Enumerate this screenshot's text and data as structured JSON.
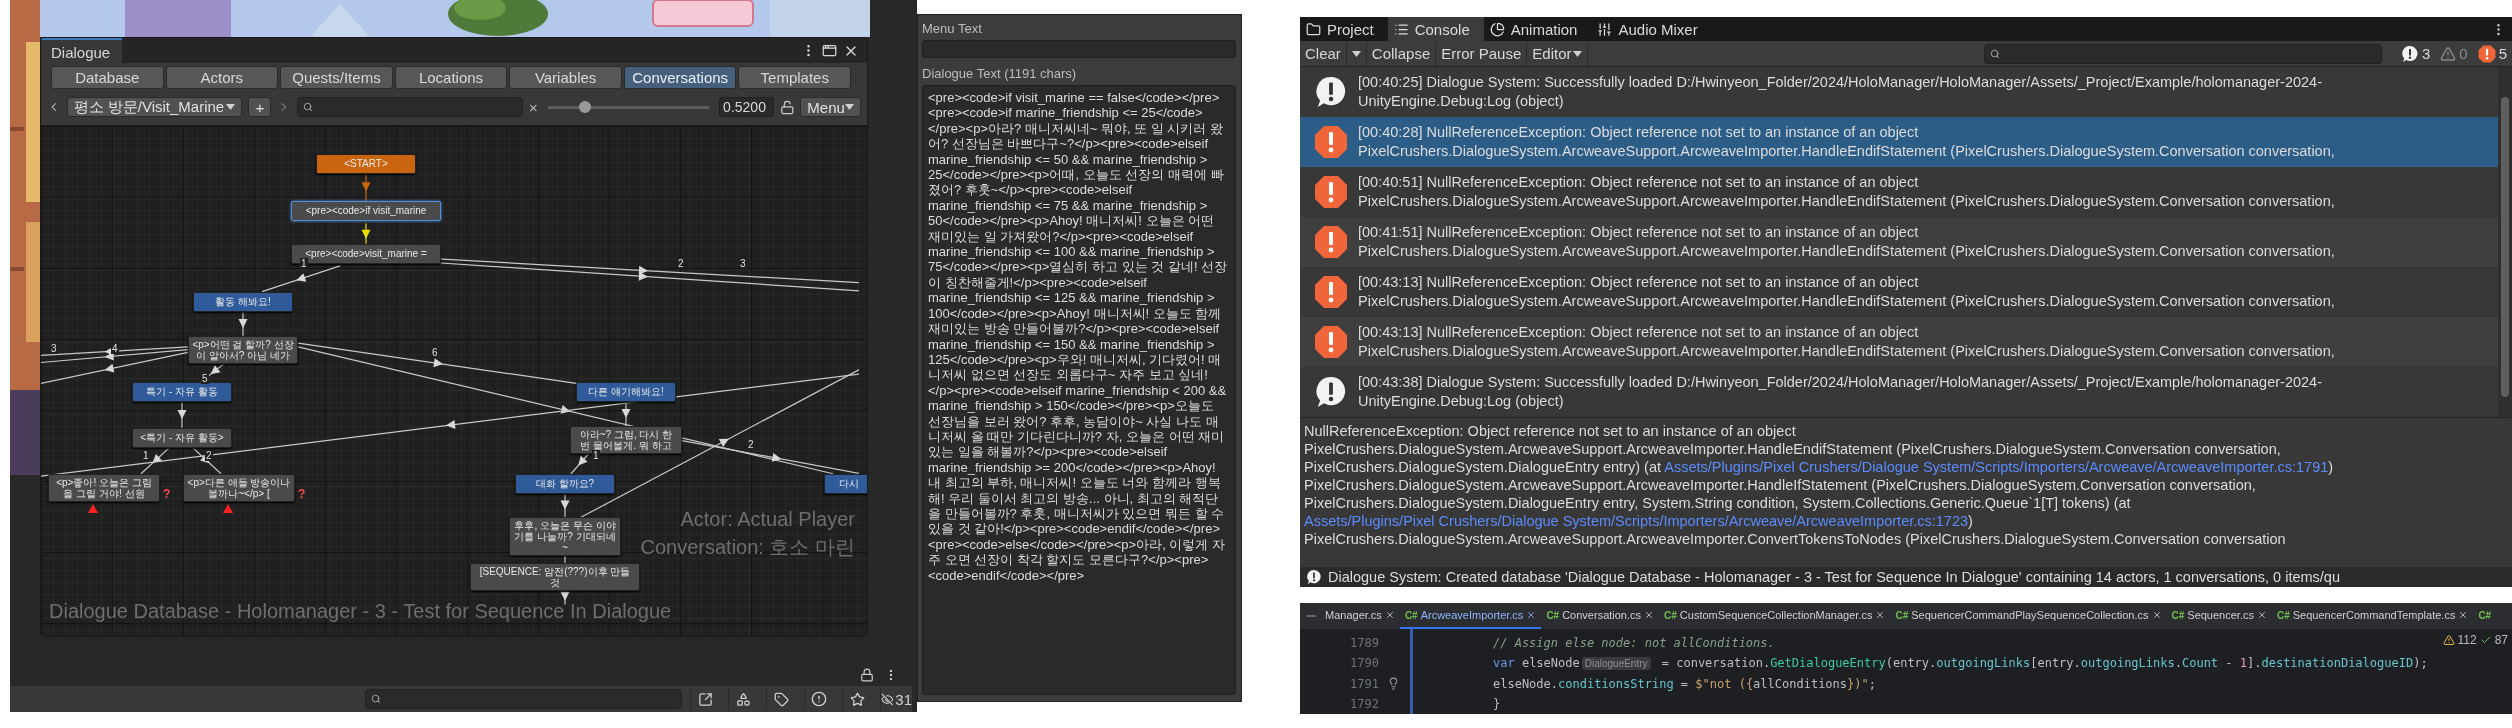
{
  "dialogue_window": {
    "title": "Dialogue",
    "tabs": [
      {
        "label": "Database",
        "selected": false
      },
      {
        "label": "Actors",
        "selected": false
      },
      {
        "label": "Quests/Items",
        "selected": false
      },
      {
        "label": "Locations",
        "selected": false
      },
      {
        "label": "Variables",
        "selected": false
      },
      {
        "label": "Conversations",
        "selected": true
      },
      {
        "label": "Templates",
        "selected": false
      }
    ],
    "toolbar": {
      "conversation": "평소 방문/Visit_Marine",
      "add": "+",
      "clear": "×",
      "zoom_slider": {
        "level": 0.23
      },
      "zoom_value": "0.5200",
      "menu": "Menu"
    },
    "graph": {
      "nodes": [
        {
          "text": "<START>",
          "kind": "start",
          "selected": false
        },
        {
          "text": "<pre><code>if visit_marine",
          "kind": "npc",
          "selected": true
        },
        {
          "text": "<pre><code>visit_marine =",
          "kind": "npc",
          "selected": false
        },
        {
          "text": "활동 해봐요!",
          "kind": "player",
          "selected": false
        },
        {
          "text": "<p>어떤 걸 할까? 선장이 알아서? 아님 네가",
          "kind": "npc",
          "selected": false
        },
        {
          "text": "특기 - 자유 활동",
          "kind": "player",
          "selected": false
        },
        {
          "text": "<특기 - 자유 활동>",
          "kind": "npc",
          "selected": false
        },
        {
          "text": "<p>좋아! 오늘은 그림을 그릴 거야! 선원",
          "kind": "npc",
          "selected": false,
          "flag": "?"
        },
        {
          "text": "<p>다른 애들 방송이나 볼까나~</p> [",
          "kind": "npc",
          "selected": false,
          "flag": "?"
        },
        {
          "text": "다른 얘기해봐요!",
          "kind": "player",
          "selected": false
        },
        {
          "text": "아라~? 그럼, 다시 한 번 물어볼게. 뭐 하고",
          "kind": "npc",
          "selected": false
        },
        {
          "text": "대화 할까요?",
          "kind": "player",
          "selected": false
        },
        {
          "text": "다시",
          "kind": "player",
          "selected": false
        },
        {
          "text": "후후, 오늘은 무슨 이야기를 나눌까? 기대되네~",
          "kind": "npc",
          "selected": false
        },
        {
          "text": "[SEQUENCE: 암전(???)이후 만들 것",
          "kind": "npc",
          "selected": false
        }
      ],
      "link_labels": [
        "1",
        "2",
        "3",
        "3",
        "4",
        "5",
        "6",
        "1",
        "2",
        "1",
        "2"
      ],
      "actor": "Actor: Actual Player",
      "database": "Dialogue Database - Holomanager - 3 - Test for Sequence In Dialogue",
      "conversation": "Conversation: 호소 마린"
    }
  },
  "bottom_bar": {
    "hidden_count": "31"
  },
  "inspector": {
    "menu_text_label": "Menu Text",
    "dialogue_text_label": "Dialogue Text (1191 chars)",
    "dialogue_text": "<pre><code>if visit_marine == false</code></pre><pre><code>if marine_friendship <= 25</code></pre><p>아라? 매니저씨네~ 뭐야, 또 일 시키러 왔어? 선장님은 바쁘다구~?</p><pre><code>elseif marine_friendship <= 50 && marine_friendship > 25</code></pre><p>어때, 오늘도 선장의 매력에 빠졌어? 후훗~</p><pre><code>elseif marine_friendship <= 75 && marine_friendship > 50</code></pre><p>Ahoy! 매니저씨! 오늘은 어떤 재미있는 일 가져왔어?</p><pre><code>elseif marine_friendship <= 100 && marine_friendship > 75</code></pre><p>열심히 하고 있는 것 같네! 선장이 칭찬해줄게!</p><pre><code>elseif marine_friendship <= 125 && marine_friendship > 100</code></pre><p>Ahoy! 매니저씨! 오늘도 함께 재미있는 방송 만들어볼까?</p><pre><code>elseif marine_friendship <= 150 && marine_friendship > 125</code></pre><p>우와! 매니저씨, 기다렸어! 매니저씨 없으면 선장도 외롭다구~ 자주 보고 싶네!</p><pre><code>elseif marine_friendship < 200 && marine_friendship > 150</code></pre><p>오늘도 선장님을 보러 왔어? 후후, 농담이야~ 사실 나도 매니저씨 올 때만 기다린다니까? 자, 오늘은 어떤 재미있는 일을 해볼까?</p><pre><code>elseif marine_friendship >= 200</code></pre><p>Ahoy! 내 최고의 부하, 매니저씨! 오늘도 너와 함께라 행복해! 우리 둘이서 최고의 방송... 아니, 최고의 해적단을 만들어볼까? 후훗, 매니저씨가 있으면 뭐든 할 수 있을 것 같아!</p><pre><code>endif</code></pre><pre><code>else</code></pre><p>아라, 이렇게 자주 오면 선장이 착각 할지도 모른다구?</p><pre><code>endif</code></pre>"
  },
  "console": {
    "tabs": [
      {
        "label": "Project",
        "selected": false
      },
      {
        "label": "Console",
        "selected": true
      },
      {
        "label": "Animation",
        "selected": false
      },
      {
        "label": "Audio Mixer",
        "selected": false
      }
    ],
    "toolbar": {
      "clear": "Clear",
      "collapse": "Collapse",
      "error_pause": "Error Pause",
      "editor": "Editor"
    },
    "counts": {
      "info": "3",
      "warning": "0",
      "error": "5"
    },
    "entries": [
      {
        "kind": "info",
        "selected": false,
        "line1": "[00:40:25] Dialogue System: Successfully loaded D:/Hwinyeon_Folder/2024/HoloManager/HoloManager/Assets/_Project/Example/holomanager-2024-",
        "line2": "UnityEngine.Debug:Log (object)"
      },
      {
        "kind": "error",
        "selected": true,
        "line1": "[00:40:28] NullReferenceException: Object reference not set to an instance of an object",
        "line2": "PixelCrushers.DialogueSystem.ArcweaveSupport.ArcweaveImporter.HandleEndifStatement (PixelCrushers.DialogueSystem.Conversation conversation,"
      },
      {
        "kind": "error",
        "selected": false,
        "line1": "[00:40:51] NullReferenceException: Object reference not set to an instance of an object",
        "line2": "PixelCrushers.DialogueSystem.ArcweaveSupport.ArcweaveImporter.HandleEndifStatement (PixelCrushers.DialogueSystem.Conversation conversation,"
      },
      {
        "kind": "error",
        "selected": false,
        "line1": "[00:41:51] NullReferenceException: Object reference not set to an instance of an object",
        "line2": "PixelCrushers.DialogueSystem.ArcweaveSupport.ArcweaveImporter.HandleEndifStatement (PixelCrushers.DialogueSystem.Conversation conversation,"
      },
      {
        "kind": "error",
        "selected": false,
        "line1": "[00:43:13] NullReferenceException: Object reference not set to an instance of an object",
        "line2": "PixelCrushers.DialogueSystem.ArcweaveSupport.ArcweaveImporter.HandleEndifStatement (PixelCrushers.DialogueSystem.Conversation conversation,"
      },
      {
        "kind": "error",
        "selected": false,
        "line1": "[00:43:13] NullReferenceException: Object reference not set to an instance of an object",
        "line2": "PixelCrushers.DialogueSystem.ArcweaveSupport.ArcweaveImporter.HandleEndifStatement (PixelCrushers.DialogueSystem.Conversation conversation,"
      },
      {
        "kind": "info",
        "selected": false,
        "line1": "[00:43:38] Dialogue System: Successfully loaded D:/Hwinyeon_Folder/2024/HoloManager/HoloManager/Assets/_Project/Example/holomanager-2024-",
        "line2": "UnityEngine.Debug:Log (object)"
      }
    ],
    "detail": [
      {
        "parts": [
          {
            "kind": "plain",
            "text": "NullReferenceException: Object reference not set to an instance of an object"
          }
        ]
      },
      {
        "parts": [
          {
            "kind": "plain",
            "text": "PixelCrushers.DialogueSystem.ArcweaveSupport.ArcweaveImporter.HandleEndifStatement (PixelCrushers.DialogueSystem.Conversation conversation, PixelCrushers.DialogueSystem.DialogueEntry entry) (at "
          },
          {
            "kind": "link",
            "text": "Assets/Plugins/Pixel Crushers/Dialogue System/Scripts/Importers/Arcweave/ArcweaveImporter.cs:1791"
          },
          {
            "kind": "plain",
            "text": ")"
          }
        ]
      },
      {
        "parts": [
          {
            "kind": "plain",
            "text": "PixelCrushers.DialogueSystem.ArcweaveSupport.ArcweaveImporter.HandleIfStatement (PixelCrushers.DialogueSystem.Conversation conversation, PixelCrushers.DialogueSystem.DialogueEntry entry, System.String condition, System.Collections.Generic.Queue`1[T] tokens) (at "
          },
          {
            "kind": "link",
            "text": "Assets/Plugins/Pixel Crushers/Dialogue System/Scripts/Importers/Arcweave/ArcweaveImporter.cs:1723"
          },
          {
            "kind": "plain",
            "text": ")"
          }
        ]
      },
      {
        "parts": [
          {
            "kind": "plain",
            "text": "PixelCrushers.DialogueSystem.ArcweaveSupport.ArcweaveImporter.ConvertTokensToNodes (PixelCrushers.DialogueSystem.Conversation conversation"
          }
        ]
      }
    ],
    "status": "Dialogue System: Created database 'Dialogue Database - Holomanager - 3 - Test for Sequence In Dialogue' containing 14 actors, 1 conversations, 0 items/qu"
  },
  "editor": {
    "tabs": [
      {
        "label": "Manager.cs",
        "selected": false
      },
      {
        "icon_text": "C#",
        "label": "ArcweaveImporter.cs",
        "selected": true
      },
      {
        "icon_text": "C#",
        "label": "Conversation.cs",
        "selected": false
      },
      {
        "icon_text": "C#",
        "label": "CustomSequenceCollectionManager.cs",
        "selected": false
      },
      {
        "icon_text": "C#",
        "label": "SequencerCommandPlaySequenceCollection.cs",
        "selected": false
      },
      {
        "icon_text": "C#",
        "label": "Sequencer.cs",
        "selected": false
      },
      {
        "icon_text": "C#",
        "label": "SequencerCommandTemplate.cs",
        "selected": false
      },
      {
        "icon_text": "C#",
        "selected": false
      }
    ],
    "inspection": {
      "warnings": "112",
      "passed": "87"
    },
    "lines": [
      {
        "number": "1789",
        "bulb": false,
        "tokens": [
          {
            "kind": "comment",
            "text": "// Assign else node: not allConditions."
          }
        ]
      },
      {
        "number": "1790",
        "bulb": false,
        "tokens": [
          {
            "kind": "keyword",
            "text": "var"
          },
          {
            "kind": "plain",
            "text": " elseNode"
          },
          {
            "kind": "hint",
            "text": "DialogueEntry"
          },
          {
            "kind": "plain",
            "text": " = conversation."
          },
          {
            "kind": "method",
            "text": "GetDialogueEntry"
          },
          {
            "kind": "plain",
            "text": "(entry."
          },
          {
            "kind": "field",
            "text": "outgoingLinks"
          },
          {
            "kind": "plain",
            "text": "[entry."
          },
          {
            "kind": "field",
            "text": "outgoingLinks"
          },
          {
            "kind": "plain",
            "text": "."
          },
          {
            "kind": "field",
            "text": "Count"
          },
          {
            "kind": "plain",
            "text": " - "
          },
          {
            "kind": "number",
            "text": "1"
          },
          {
            "kind": "plain",
            "text": "]."
          },
          {
            "kind": "field",
            "text": "destinationDialogueID"
          },
          {
            "kind": "plain",
            "text": ");"
          }
        ]
      },
      {
        "number": "1791",
        "bulb": true,
        "tokens": [
          {
            "kind": "plain",
            "text": "elseNode."
          },
          {
            "kind": "field",
            "text": "conditionsString"
          },
          {
            "kind": "plain",
            "text": " = "
          },
          {
            "kind": "string",
            "text": "$\"not ({"
          },
          {
            "kind": "plain",
            "text": "allConditions"
          },
          {
            "kind": "string",
            "text": "})\""
          },
          {
            "kind": "plain",
            "text": ";"
          }
        ]
      },
      {
        "number": "1792",
        "bulb": false,
        "tokens": [
          {
            "kind": "plain",
            "text": "}"
          }
        ]
      }
    ]
  }
}
